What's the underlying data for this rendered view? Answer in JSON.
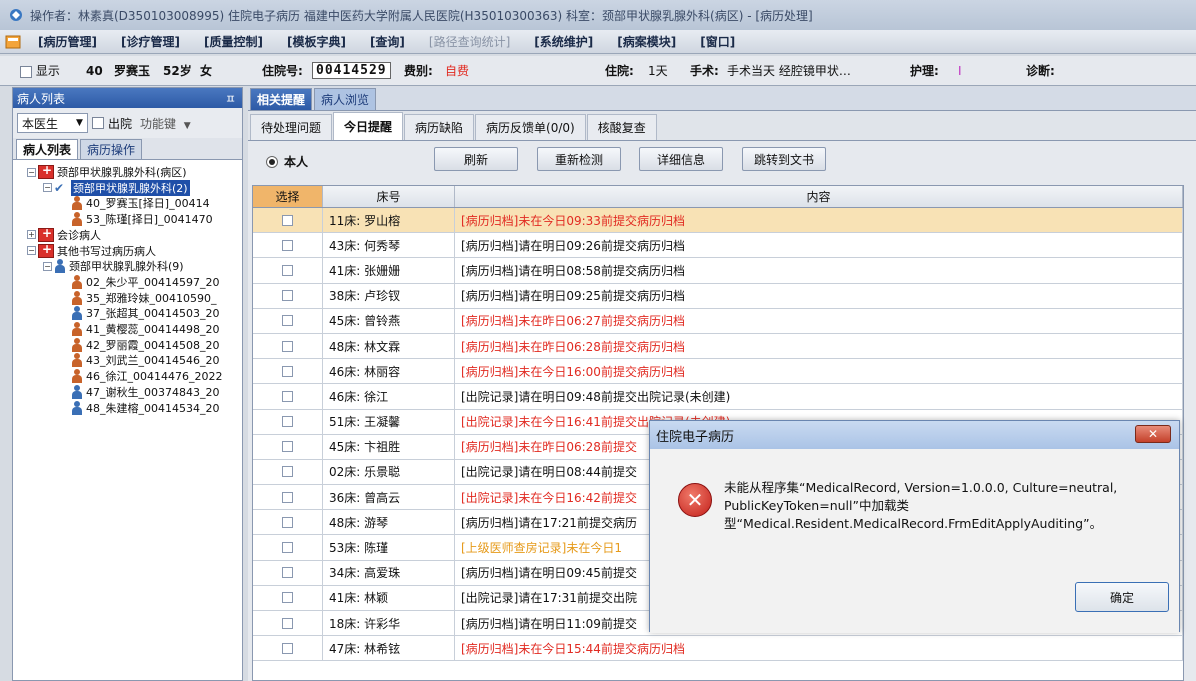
{
  "window": {
    "title": "操作者：林素真(D350103008995) 住院电子病历  福建中医药大学附属人民医院(H35010300363)  科室：颈部甲状腺乳腺外科(病区) - [病历处理]"
  },
  "menu": {
    "items": [
      {
        "label": "[病历管理]",
        "dim": false
      },
      {
        "label": "[诊疗管理]",
        "dim": false
      },
      {
        "label": "[质量控制]",
        "dim": false
      },
      {
        "label": "[模板字典]",
        "dim": false
      },
      {
        "label": "[查询]",
        "dim": false
      },
      {
        "label": "[路径查询统计]",
        "dim": true
      },
      {
        "label": "[系统维护]",
        "dim": false
      },
      {
        "label": "[病案模块]",
        "dim": false
      },
      {
        "label": "[窗口]",
        "dim": false
      }
    ]
  },
  "patient": {
    "show_label": "显示",
    "bed": "40",
    "name": "罗赛玉",
    "age": "52岁",
    "sex": "女",
    "admission_no_label": "住院号:",
    "admission_no": "00414529",
    "fee_label": "费别:",
    "fee": "自费",
    "stay_label": "住院:",
    "stay": "1天",
    "surgery_label": "手术:",
    "surgery": "手术当天  经腔镜甲状…",
    "nursing_label": "护理:",
    "nursing": "I",
    "diagnosis_label": "诊断:"
  },
  "left_panel": {
    "title": "病人列表",
    "pin": "ㅍ",
    "doctor_combo": "本医生",
    "discharged_label": "出院",
    "function_key": "功能键",
    "tabs": [
      "病人列表",
      "病历操作"
    ],
    "tree": [
      {
        "text": "颈部甲状腺乳腺外科(病区)",
        "type": "folder",
        "exp": "−",
        "indent": 0
      },
      {
        "text": "颈部甲状腺乳腺外科(2)",
        "type": "check",
        "exp": "−",
        "indent": 1,
        "selected": true
      },
      {
        "text": "40_罗赛玉[择日]_00414",
        "type": "f",
        "indent": 2
      },
      {
        "text": "53_陈瑾[择日]_0041470",
        "type": "f",
        "indent": 2
      },
      {
        "text": "会诊病人",
        "type": "folder",
        "exp": "+",
        "indent": 0
      },
      {
        "text": "其他书写过病历病人",
        "type": "folder",
        "exp": "−",
        "indent": 0
      },
      {
        "text": "颈部甲状腺乳腺外科(9)",
        "type": "group",
        "exp": "−",
        "indent": 1
      },
      {
        "text": "02_朱少平_00414597_20",
        "type": "f",
        "indent": 2
      },
      {
        "text": "35_郑雅玲妹_00410590_",
        "type": "f",
        "indent": 2
      },
      {
        "text": "37_张超其_00414503_20",
        "type": "m",
        "indent": 2
      },
      {
        "text": "41_黄樱蕊_00414498_20",
        "type": "f",
        "indent": 2
      },
      {
        "text": "42_罗丽霞_00414508_20",
        "type": "f",
        "indent": 2
      },
      {
        "text": "43_刘武兰_00414546_20",
        "type": "f",
        "indent": 2
      },
      {
        "text": "46_徐江_00414476_2022",
        "type": "f",
        "indent": 2
      },
      {
        "text": "47_谢秋生_00374843_20",
        "type": "m",
        "indent": 2
      },
      {
        "text": "48_朱建榕_00414534_20",
        "type": "m",
        "indent": 2
      }
    ]
  },
  "main": {
    "top_tabs": [
      "相关提醒",
      "病人浏览"
    ],
    "sub_tabs": [
      "待处理问题",
      "今日提醒",
      "病历缺陷",
      "病历反馈单(0/0)",
      "核酸复查"
    ],
    "radio_label": "本人",
    "buttons": [
      "刷新",
      "重新检测",
      "详细信息",
      "跳转到文书"
    ],
    "grid_headers": {
      "select": "选择",
      "bed": "床号",
      "content": "内容"
    },
    "rows": [
      {
        "bed": "11床: 罗山榕",
        "content": "[病历归档]未在今日09:33前提交病历归档",
        "color": "red"
      },
      {
        "bed": "43床: 何秀琴",
        "content": "[病历归档]请在明日09:26前提交病历归档",
        "color": "normal"
      },
      {
        "bed": "41床: 张姗姗",
        "content": "[病历归档]请在明日08:58前提交病历归档",
        "color": "normal"
      },
      {
        "bed": "38床: 卢珍钗",
        "content": "[病历归档]请在明日09:25前提交病历归档",
        "color": "normal"
      },
      {
        "bed": "45床: 曾铃燕",
        "content": "[病历归档]未在昨日06:27前提交病历归档",
        "color": "red"
      },
      {
        "bed": "48床: 林文霖",
        "content": "[病历归档]未在昨日06:28前提交病历归档",
        "color": "red"
      },
      {
        "bed": "46床: 林丽容",
        "content": "[病历归档]未在今日16:00前提交病历归档",
        "color": "red"
      },
      {
        "bed": "46床: 徐江",
        "content": "[出院记录]请在明日09:48前提交出院记录(未创建)",
        "color": "normal"
      },
      {
        "bed": "51床: 王凝馨",
        "content": "[出院记录]未在今日16:41前提交出院记录(未创建)",
        "color": "red"
      },
      {
        "bed": "45床: 卞祖胜",
        "content": "[病历归档]未在昨日06:28前提交",
        "color": "red"
      },
      {
        "bed": "02床: 乐景聪",
        "content": "[出院记录]请在明日08:44前提交",
        "color": "normal"
      },
      {
        "bed": "36床: 曾高云",
        "content": "[出院记录]未在今日16:42前提交",
        "color": "red"
      },
      {
        "bed": "48床: 游琴",
        "content": "[病历归档]请在17:21前提交病历",
        "color": "normal"
      },
      {
        "bed": "53床: 陈瑾",
        "content": "[上级医师查房记录]未在今日1",
        "color": "orange"
      },
      {
        "bed": "34床: 高爱珠",
        "content": "[病历归档]请在明日09:45前提交",
        "color": "normal"
      },
      {
        "bed": "41床: 林颖",
        "content": "[出院记录]请在17:31前提交出院",
        "color": "normal"
      },
      {
        "bed": "18床: 许彩华",
        "content": "[病历归档]请在明日11:09前提交",
        "color": "normal"
      },
      {
        "bed": "47床: 林希铉",
        "content": "[病历归档]未在今日15:44前提交病历归档",
        "color": "red"
      }
    ]
  },
  "dialog": {
    "title": "住院电子病历",
    "close": "✕",
    "message": "未能从程序集“MedicalRecord, Version=1.0.0.0, Culture=neutral, PublicKeyToken=null”中加载类型“Medical.Resident.MedicalRecord.FrmEditApplyAuditing”。",
    "ok": "确定"
  },
  "colors": {
    "red": "#e12b22",
    "orange": "#e69a1a",
    "selection": "#1f4fa8",
    "header_accent": "#f0b56a"
  }
}
